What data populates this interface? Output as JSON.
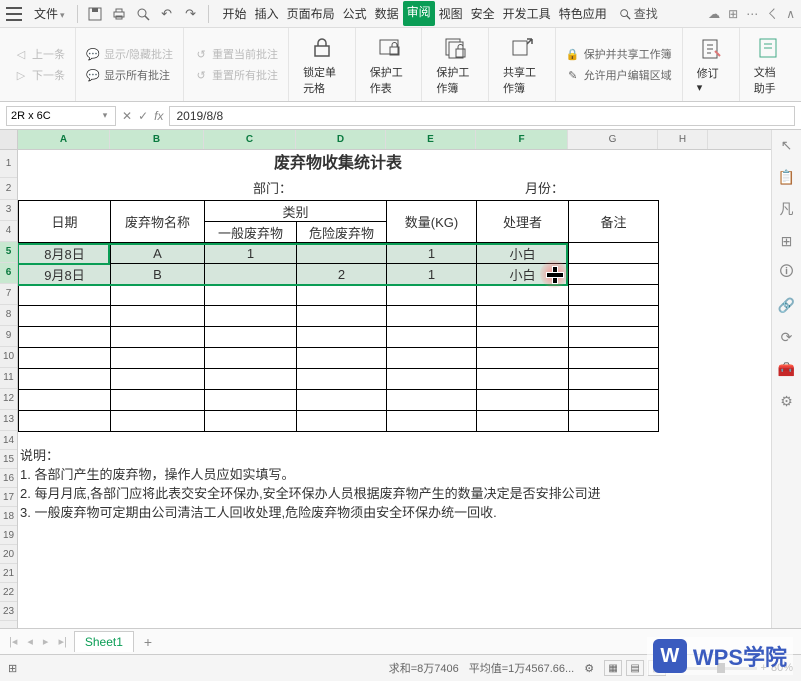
{
  "menubar": {
    "file_label": "文件",
    "tabs": [
      "开始",
      "插入",
      "页面布局",
      "公式",
      "数据",
      "审阅",
      "视图",
      "安全",
      "开发工具",
      "特色应用"
    ],
    "active_tab_index": 5,
    "search_label": "查找"
  },
  "ribbon": {
    "prev_comment": "上一条",
    "next_comment": "下一条",
    "show_hide_comment": "显示/隐藏批注",
    "show_all_comments": "显示所有批注",
    "reset_current": "重置当前批注",
    "reset_all": "重置所有批注",
    "lock_cell": "锁定单元格",
    "protect_sheet": "保护工作表",
    "protect_workbook": "保护工作簿",
    "share_workbook": "共享工作簿",
    "protect_share": "保护并共享工作簿",
    "allow_edit_ranges": "允许用户编辑区域",
    "revisions": "修订",
    "doc_assistant": "文档助手"
  },
  "formula_bar": {
    "name_box": "2R x 6C",
    "fx_label": "fx",
    "formula_value": "2019/8/8"
  },
  "columns": [
    "A",
    "B",
    "C",
    "D",
    "E",
    "F",
    "G",
    "H"
  ],
  "rows_visible": 23,
  "selected_rows": [
    5,
    6
  ],
  "selected_cols": [
    "A",
    "B",
    "C",
    "D",
    "E",
    "F"
  ],
  "sheet": {
    "title": "废弃物收集统计表",
    "dept_label": "部门：",
    "month_label": "月份：",
    "headers": {
      "date": "日期",
      "waste_name": "废弃物名称",
      "category": "类别",
      "general_waste": "一般废弃物",
      "hazard_waste": "危险废弃物",
      "quantity": "数量(KG)",
      "handler": "处理者",
      "remark": "备注"
    },
    "data_rows": [
      {
        "date": "8月8日",
        "name": "A",
        "general": "1",
        "hazard": "",
        "qty": "1",
        "handler": "小白",
        "remark": ""
      },
      {
        "date": "9月8日",
        "name": "B",
        "general": "",
        "hazard": "2",
        "qty": "1",
        "handler": "小白",
        "remark": ""
      }
    ],
    "empty_rows": 7,
    "notes_title": "说明：",
    "notes": [
      "1.        各部门产生的废弃物，操作人员应如实填写。",
      "2.        每月月底,各部门应将此表交安全环保办,安全环保办人员根据废弃物产生的数量决定是否安排公司进",
      "3.        一般废弃物可定期由公司清洁工人回收处理,危险废弃物须由安全环保办统一回收."
    ]
  },
  "sheet_tabs": {
    "active": "Sheet1"
  },
  "status_bar": {
    "sum_label": "求和=8万7406",
    "avg_label": "平均值=1万4567.66...",
    "zoom": "80%"
  },
  "watermark": "WPS学院"
}
